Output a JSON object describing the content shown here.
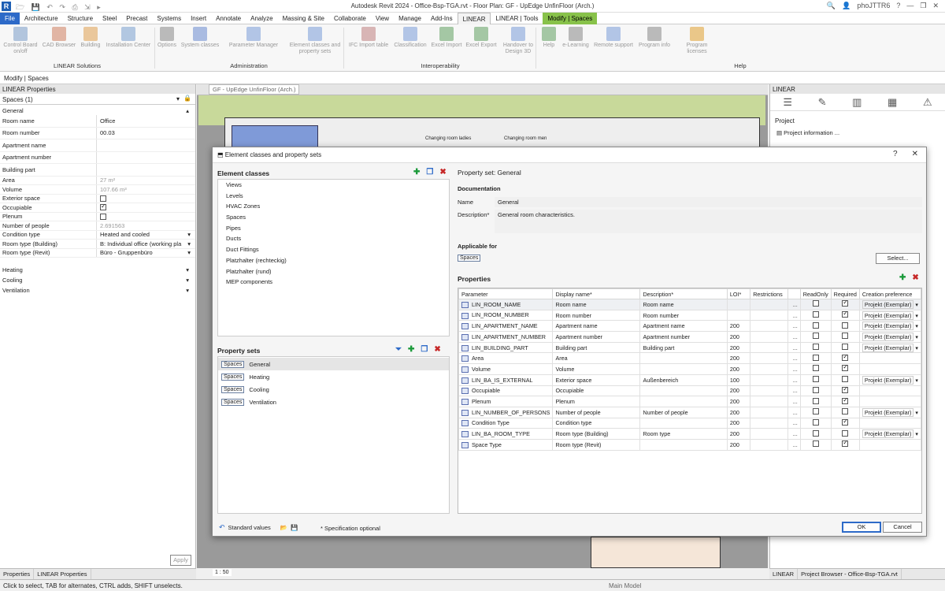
{
  "app": {
    "logo": "R",
    "title": "Autodesk Revit 2024 - Office-Bsp-TGA.rvt - Floor Plan: GF - UpEdge UnfinFloor (Arch.)",
    "user": "phoJTTR6"
  },
  "menu_tabs": [
    "File",
    "Architecture",
    "Structure",
    "Steel",
    "Precast",
    "Systems",
    "Insert",
    "Annotate",
    "Analyze",
    "Massing & Site",
    "Collaborate",
    "View",
    "Manage",
    "Add-Ins",
    "LINEAR",
    "LINEAR | Tools",
    "Modify | Spaces"
  ],
  "ribbon": {
    "buttons": [
      "Control Board on/off",
      "CAD Browser",
      "Building",
      "Installation Center",
      "Options",
      "System classes",
      "Parameter Manager",
      "Element classes and property sets",
      "IFC Import table",
      "Classification",
      "Excel Import",
      "Excel Export",
      "Handover to Design 3D",
      "Help",
      "e-Learning",
      "Remote support",
      "Program info",
      "Program licenses"
    ],
    "groups": [
      "LINEAR Solutions",
      "Administration",
      "Interoperability",
      "Help"
    ]
  },
  "modify_bar": "Modify | Spaces",
  "properties": {
    "header": "LINEAR Properties",
    "type_selector": "Spaces (1)",
    "group_general": "General",
    "rows": [
      {
        "k": "Room name",
        "v": "Office"
      },
      {
        "k": "Room number",
        "v": "00.03"
      },
      {
        "k": "Apartment name",
        "v": ""
      },
      {
        "k": "Apartment number",
        "v": ""
      },
      {
        "k": "Building part",
        "v": ""
      }
    ],
    "small_rows": [
      {
        "k": "Area",
        "v": "27 m²"
      },
      {
        "k": "Volume",
        "v": "107.66 m³"
      },
      {
        "k": "Exterior space",
        "v": ""
      },
      {
        "k": "Occupiable",
        "v": ""
      },
      {
        "k": "Plenum",
        "v": ""
      },
      {
        "k": "Number of people",
        "v": "2.691563"
      },
      {
        "k": "Condition type",
        "v": "Heated and cooled"
      },
      {
        "k": "Room type (Building)",
        "v": "B: Individual office (working pla"
      },
      {
        "k": "Room type (Revit)",
        "v": "Büro - Gruppenbüro"
      }
    ],
    "groups": [
      "Heating",
      "Cooling",
      "Ventilation"
    ],
    "apply": "Apply",
    "bottom_tabs": [
      "Properties",
      "LINEAR Properties"
    ]
  },
  "drawing": {
    "tab": "GF - UpEdge UnfinFloor (Arch.)",
    "labels": [
      "Changing room ladies",
      "Changing room men"
    ]
  },
  "right_panel": {
    "header": "LINEAR",
    "project": "Project",
    "project_info": "Project information ...",
    "bottom_tabs": [
      "LINEAR",
      "Project Browser - Office-Bsp-TGA.rvt"
    ]
  },
  "status": {
    "text": "Click to select, TAB for alternates, CTRL adds, SHIFT unselects.",
    "scale": "1 : 50",
    "model": "Main Model"
  },
  "dialog": {
    "title": "Element classes and property sets",
    "help": "?",
    "close": "✕",
    "element_classes_title": "Element classes",
    "element_classes": [
      "Views",
      "Levels",
      "HVAC Zones",
      "Spaces",
      "Pipes",
      "Ducts",
      "Duct Fittings",
      "Platzhalter (rechteckig)",
      "Platzhalter (rund)",
      "MEP components"
    ],
    "property_sets_title": "Property sets",
    "property_sets": [
      {
        "tag": "Spaces",
        "name": "General"
      },
      {
        "tag": "Spaces",
        "name": "Heating"
      },
      {
        "tag": "Spaces",
        "name": "Cooling"
      },
      {
        "tag": "Spaces",
        "name": "Ventilation"
      }
    ],
    "pset_title": "Property set: General",
    "documentation": "Documentation",
    "name_label": "Name",
    "name_value": "General",
    "desc_label": "Description*",
    "desc_value": "General room characteristics.",
    "applicable_for": "Applicable for",
    "applicable_tag": "Spaces",
    "select_button": "Select...",
    "properties_title": "Properties",
    "columns": [
      "Parameter",
      "Display name*",
      "Description*",
      "LOI*",
      "Restrictions",
      "",
      "ReadOnly",
      "Required",
      "Creation preference"
    ],
    "rows": [
      {
        "p": "LIN_ROOM_NAME",
        "d": "Room name",
        "ds": "Room name",
        "l": "",
        "ro": false,
        "rq": true,
        "c": "Projekt (Exemplar)"
      },
      {
        "p": "LIN_ROOM_NUMBER",
        "d": "Room number",
        "ds": "Room number",
        "l": "",
        "ro": false,
        "rq": true,
        "c": "Projekt (Exemplar)"
      },
      {
        "p": "LIN_APARTMENT_NAME",
        "d": "Apartment name",
        "ds": "Apartment name",
        "l": "200",
        "ro": false,
        "rq": false,
        "c": "Projekt (Exemplar)"
      },
      {
        "p": "LIN_APARTMENT_NUMBER",
        "d": "Apartment number",
        "ds": "Apartment number",
        "l": "200",
        "ro": false,
        "rq": false,
        "c": "Projekt (Exemplar)"
      },
      {
        "p": "LIN_BUILDING_PART",
        "d": "Building part",
        "ds": "Building part",
        "l": "200",
        "ro": false,
        "rq": false,
        "c": "Projekt (Exemplar)"
      },
      {
        "p": "Area",
        "d": "Area",
        "ds": "",
        "l": "200",
        "ro": false,
        "rq": true,
        "c": ""
      },
      {
        "p": "Volume",
        "d": "Volume",
        "ds": "",
        "l": "200",
        "ro": false,
        "rq": true,
        "c": ""
      },
      {
        "p": "LIN_BA_IS_EXTERNAL",
        "d": "Exterior space",
        "ds": "Außenbereich",
        "l": "100",
        "ro": false,
        "rq": false,
        "c": "Projekt (Exemplar)"
      },
      {
        "p": "Occupiable",
        "d": "Occupiable",
        "ds": "",
        "l": "200",
        "ro": false,
        "rq": true,
        "c": ""
      },
      {
        "p": "Plenum",
        "d": "Plenum",
        "ds": "",
        "l": "200",
        "ro": false,
        "rq": true,
        "c": ""
      },
      {
        "p": "LIN_NUMBER_OF_PERSONS",
        "d": "Number of people",
        "ds": "Number of people",
        "l": "200",
        "ro": false,
        "rq": false,
        "c": "Projekt (Exemplar)"
      },
      {
        "p": "Condition Type",
        "d": "Condition type",
        "ds": "",
        "l": "200",
        "ro": false,
        "rq": true,
        "c": ""
      },
      {
        "p": "LIN_BA_ROOM_TYPE",
        "d": "Room type (Building)",
        "ds": "Room type",
        "l": "200",
        "ro": false,
        "rq": false,
        "c": "Projekt (Exemplar)"
      },
      {
        "p": "Space Type",
        "d": "Room type (Revit)",
        "ds": "",
        "l": "200",
        "ro": false,
        "rq": true,
        "c": ""
      }
    ],
    "standard_values": "Standard values",
    "spec_note": "* Specification optional",
    "ok": "OK",
    "cancel": "Cancel"
  }
}
